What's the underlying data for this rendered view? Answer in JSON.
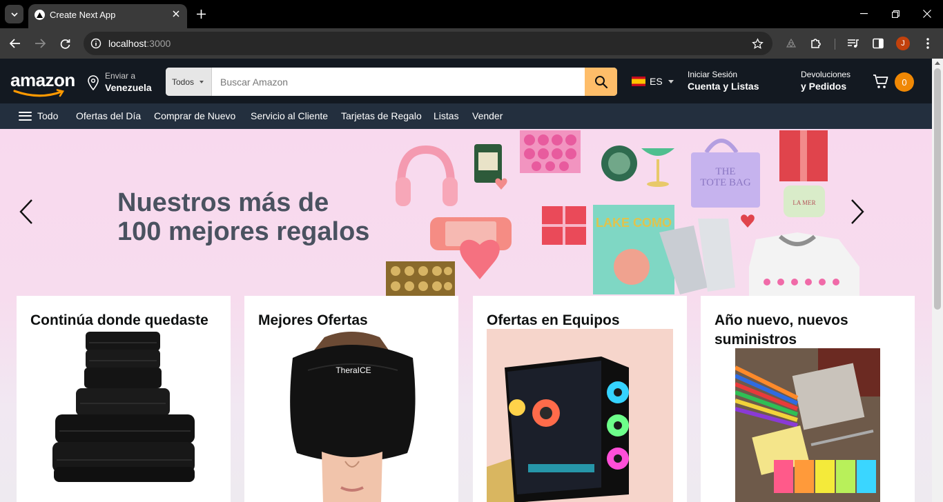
{
  "browser": {
    "tab_title": "Create Next App",
    "url_host": "localhost",
    "url_port": ":3000",
    "profile_initial": "J"
  },
  "header": {
    "logo_text": "amazon",
    "deliver_line1": "Enviar a",
    "deliver_line2": "Venezuela",
    "search_category": "Todos",
    "search_placeholder": "Buscar Amazon",
    "language": "ES",
    "account_line1": "Iniciar Sesión",
    "account_line2": "Cuenta y Listas",
    "orders_line1": "Devoluciones",
    "orders_line2": "y Pedidos",
    "cart_count": "0",
    "accent_color": "#febd69"
  },
  "subnav": {
    "all_label": "Todo",
    "items": [
      "Ofertas del Día",
      "Comprar de Nuevo",
      "Servicio al Cliente",
      "Tarjetas de Regalo",
      "Listas",
      "Vender"
    ]
  },
  "hero": {
    "line1": "Nuestros más de",
    "line2": "100 mejores regalos"
  },
  "cards": [
    {
      "title": "Continúa donde quedaste",
      "image": "black-towels"
    },
    {
      "title": "Mejores Ofertas",
      "image": "therapy-head-wrap"
    },
    {
      "title": "Ofertas en Equipos",
      "image": "gaming-pc-case"
    },
    {
      "title": "Año nuevo, nuevos suministros",
      "image": "school-supplies"
    }
  ]
}
